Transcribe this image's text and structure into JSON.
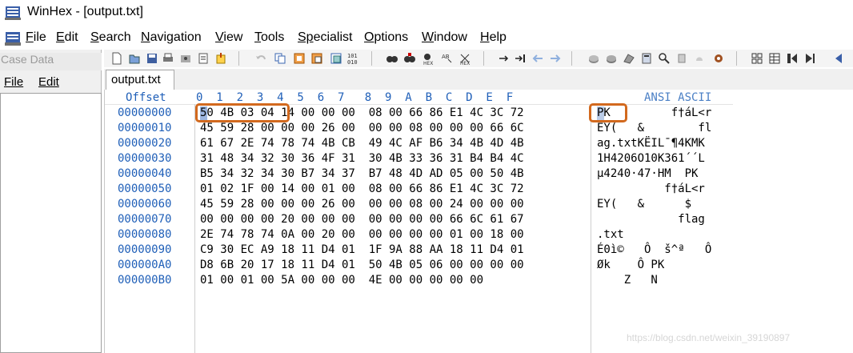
{
  "window": {
    "title": "WinHex - [output.txt]"
  },
  "menu": {
    "items": [
      {
        "key": "F",
        "rest": "ile"
      },
      {
        "key": "E",
        "rest": "dit"
      },
      {
        "key": "S",
        "rest": "earch"
      },
      {
        "key": "N",
        "rest": "avigation"
      },
      {
        "key": "V",
        "rest": "iew"
      },
      {
        "key": "T",
        "rest": "ools"
      },
      {
        "key": "Sp",
        "rest": "ecialist"
      },
      {
        "key": "O",
        "rest": "ptions"
      },
      {
        "key": "W",
        "rest": "indow"
      },
      {
        "key": "H",
        "rest": "elp"
      }
    ]
  },
  "case_panel": {
    "title": "Case Data",
    "menu": [
      "File",
      "Edit"
    ]
  },
  "tab": {
    "label": "output.txt"
  },
  "hex_view": {
    "offset_header": "Offset",
    "hex_header": "0  1  2  3  4  5  6  7   8  9  A  B  C  D  E  F",
    "ascii_header": "ANSI ASCII",
    "offsets": "00000000\n00000010\n00000020\n00000030\n00000040\n00000050\n00000060\n00000070\n00000080\n00000090\n000000A0\n000000B0",
    "hex_rows": "50 4B 03 04 14 00 00 00  08 00 66 86 E1 4C 3C 72\n45 59 28 00 00 00 26 00  00 00 08 00 00 00 66 6C\n61 67 2E 74 78 74 4B CB  49 4C AF B6 34 4B 4D 4B\n31 48 34 32 30 36 4F 31  30 4B 33 36 31 B4 B4 4C\nB5 34 32 34 30 B7 34 37  B7 48 4D AD 05 00 50 4B\n01 02 1F 00 14 00 01 00  08 00 66 86 E1 4C 3C 72\n45 59 28 00 00 00 26 00  00 00 08 00 24 00 00 00\n00 00 00 00 20 00 00 00  00 00 00 00 66 6C 61 67\n2E 74 78 74 0A 00 20 00  00 00 00 00 01 00 18 00\nC9 30 EC A9 18 11 D4 01  1F 9A 88 AA 18 11 D4 01\nD8 6B 20 17 18 11 D4 01  50 4B 05 06 00 00 00 00\n01 00 01 00 5A 00 00 00  4E 00 00 00 00 00",
    "ascii_rows": "PK         f†áL<r\nEY(   &        fl\nag.txtKËIL¯¶4KMK\n1H4206O10K361´´L\nµ4240·47·HM­  PK\n          f†áL<r\nEY(   &      $\n            flag\n.txt\nÉ0ì©   Ô  š^ª   Ô\nØk    Ô PK\n    Z   N"
  },
  "watermark": "https://blog.csdn.net/weixin_39190897",
  "colors": {
    "accent_blue": "#1f5fb8",
    "highlight_orange": "#d2691e"
  }
}
